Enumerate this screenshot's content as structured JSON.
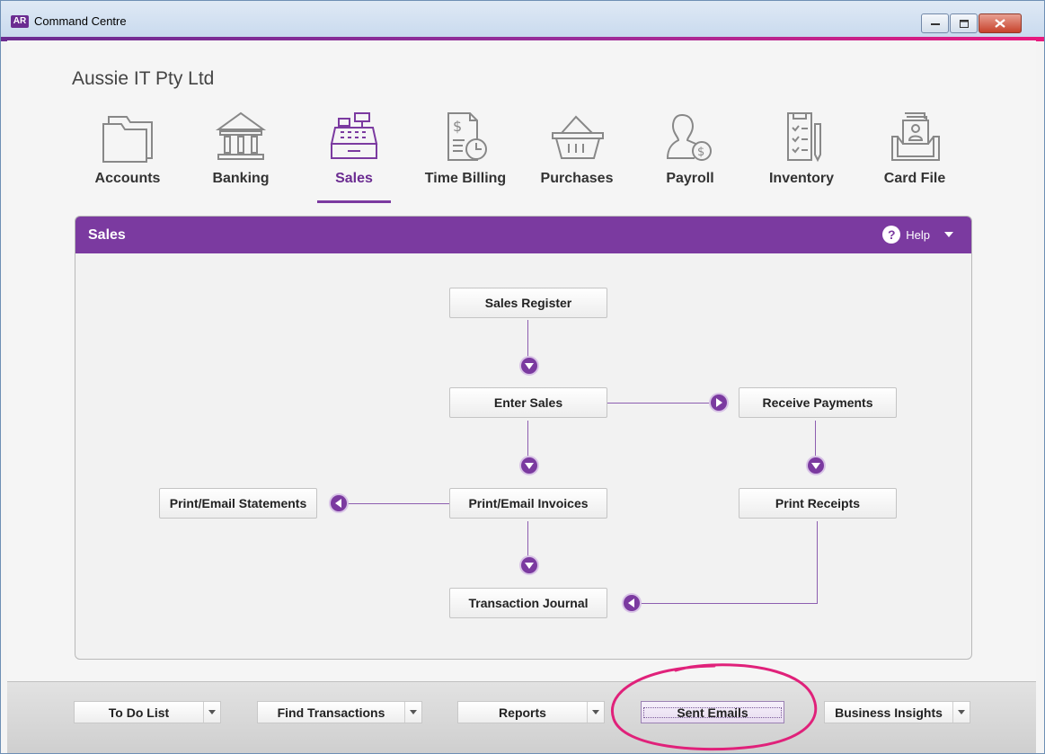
{
  "window": {
    "app_badge": "AR",
    "title": "Command Centre"
  },
  "company_name": "Aussie IT Pty Ltd",
  "nav": {
    "items": [
      {
        "label": "Accounts"
      },
      {
        "label": "Banking"
      },
      {
        "label": "Sales",
        "active": true
      },
      {
        "label": "Time Billing"
      },
      {
        "label": "Purchases"
      },
      {
        "label": "Payroll"
      },
      {
        "label": "Inventory"
      },
      {
        "label": "Card File"
      }
    ]
  },
  "panel": {
    "title": "Sales",
    "help_label": "Help",
    "help_symbol": "?"
  },
  "flow": {
    "sales_register": "Sales Register",
    "enter_sales": "Enter Sales",
    "receive_payments": "Receive Payments",
    "print_email_statements": "Print/Email Statements",
    "print_email_invoices": "Print/Email Invoices",
    "print_receipts": "Print Receipts",
    "transaction_journal": "Transaction Journal"
  },
  "bottom": {
    "todo": "To Do List",
    "find": "Find Transactions",
    "reports": "Reports",
    "sent_emails": "Sent Emails",
    "insights": "Business Insights"
  },
  "colors": {
    "accent_purple": "#7b3aa0",
    "highlight_pink": "#e0217a"
  }
}
